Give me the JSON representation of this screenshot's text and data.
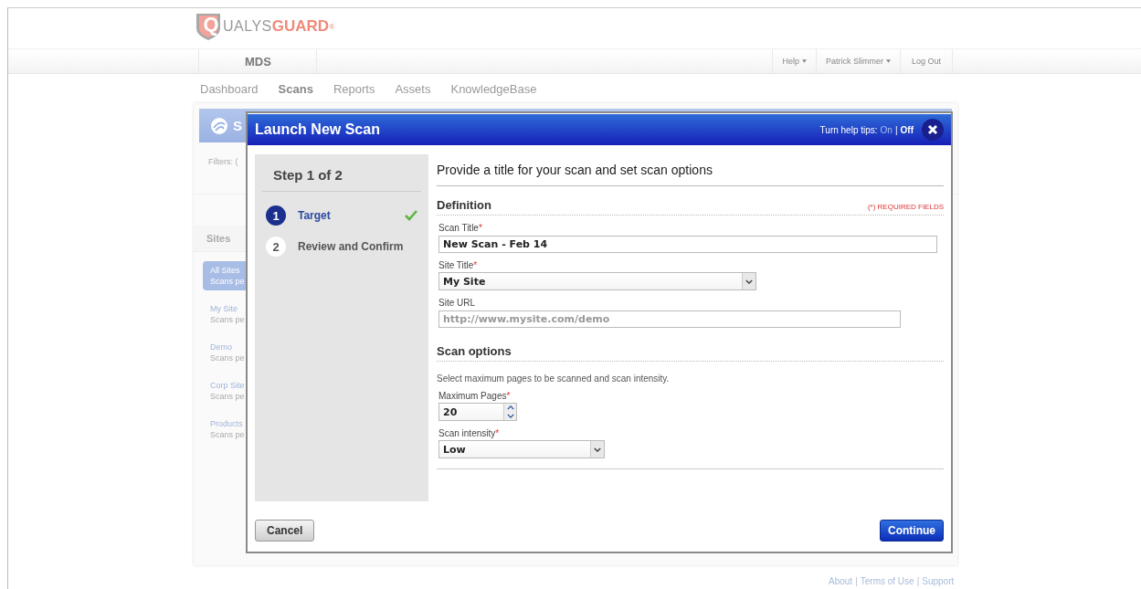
{
  "logo": {
    "initial": "Q",
    "text": "UALYS",
    "accent": "GUARD",
    "mark": "®"
  },
  "topbar": {
    "account": "MDS",
    "menu": [
      {
        "label": "Help",
        "dropdown": true
      },
      {
        "label": "Patrick Slimmer",
        "dropdown": true
      },
      {
        "label": "Log Out",
        "dropdown": false
      }
    ]
  },
  "tabs": [
    {
      "label": "Dashboard",
      "selected": false
    },
    {
      "label": "Scans",
      "selected": true
    },
    {
      "label": "Reports",
      "selected": false
    },
    {
      "label": "Assets",
      "selected": false
    },
    {
      "label": "KnowledgeBase",
      "selected": false
    }
  ],
  "background_panel": {
    "title": "S",
    "filters": "Filters: (",
    "sites_heading": "Sites",
    "sites": [
      {
        "name": "All Sites",
        "sub": "Scans pe",
        "selected": true
      },
      {
        "name": "My Site",
        "sub": "Scans pe",
        "selected": false
      },
      {
        "name": "Demo",
        "sub": "Scans pe",
        "selected": false
      },
      {
        "name": "Corp Site",
        "sub": "Scans pe",
        "selected": false
      },
      {
        "name": "Products",
        "sub": "Scans pe",
        "selected": false
      }
    ]
  },
  "dialog": {
    "title": "Launch New Scan",
    "help_tips": {
      "label": "Turn help tips:",
      "separator": "|",
      "options": [
        {
          "label": "On",
          "selected": false
        },
        {
          "label": "Off",
          "selected": true
        }
      ]
    },
    "step_heading": "Step 1 of 2",
    "steps": [
      {
        "number": "1",
        "label": "Target",
        "selected": true,
        "done": true
      },
      {
        "number": "2",
        "label": "Review and Confirm",
        "selected": false,
        "done": false
      }
    ],
    "intro": "Provide a title for your scan and set scan options",
    "sections": [
      {
        "title": "Definition",
        "note": "(*) REQUIRED FIELDS",
        "fields": [
          {
            "kind": "text",
            "label": "Scan Title",
            "mark": "*",
            "value": "New Scan - Feb 14"
          },
          {
            "kind": "select",
            "label": "Site Title",
            "mark": "*",
            "value": "My Site"
          },
          {
            "kind": "text",
            "label": "Site URL",
            "placeholder": "http://www.mysite.com/demo"
          }
        ]
      },
      {
        "title": "Scan options",
        "description": "Select maximum pages to be scanned and scan intensity.",
        "fields": [
          {
            "kind": "number",
            "label": "Maximum Pages",
            "mark": "*",
            "value": "20"
          },
          {
            "kind": "select",
            "label": "Scan intensity",
            "mark": "*",
            "value": "Low"
          }
        ]
      }
    ],
    "cancel": "Cancel",
    "continue": "Continue"
  },
  "footer": [
    {
      "kind": "link",
      "text": "About"
    },
    {
      "kind": "separator",
      "text": "|"
    },
    {
      "kind": "link",
      "text": "Terms of Use"
    },
    {
      "kind": "separator",
      "text": "|"
    },
    {
      "kind": "link",
      "text": "Support"
    }
  ]
}
